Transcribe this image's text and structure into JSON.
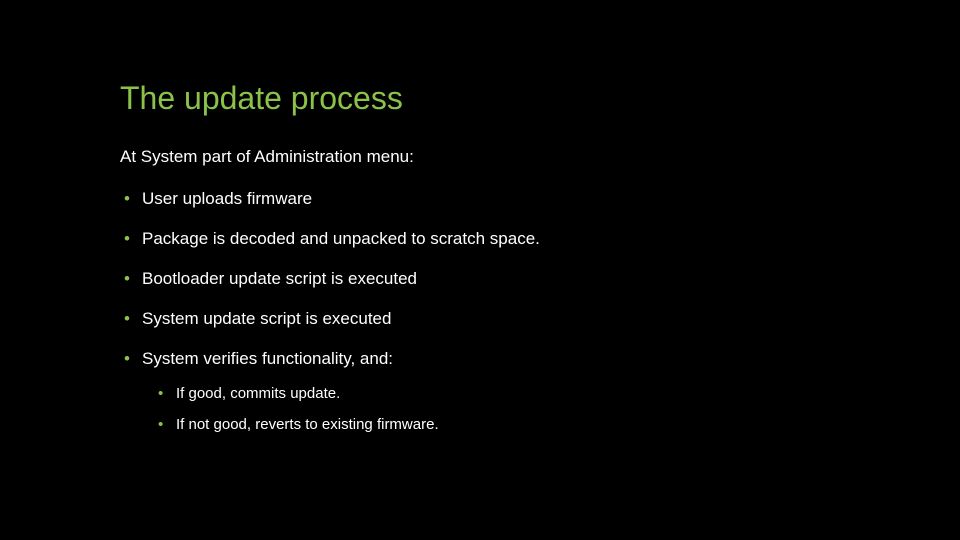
{
  "title": "The update process",
  "intro": "At System part of Administration menu:",
  "bullets": [
    {
      "text": "User uploads firmware"
    },
    {
      "text": "Package is decoded and unpacked to scratch space."
    },
    {
      "text": "Bootloader update script is executed"
    },
    {
      "text": "System update script is executed"
    },
    {
      "text": "System verifies functionality, and:",
      "sub": [
        "If good, commits update.",
        "If not good, reverts to existing firmware."
      ]
    }
  ]
}
